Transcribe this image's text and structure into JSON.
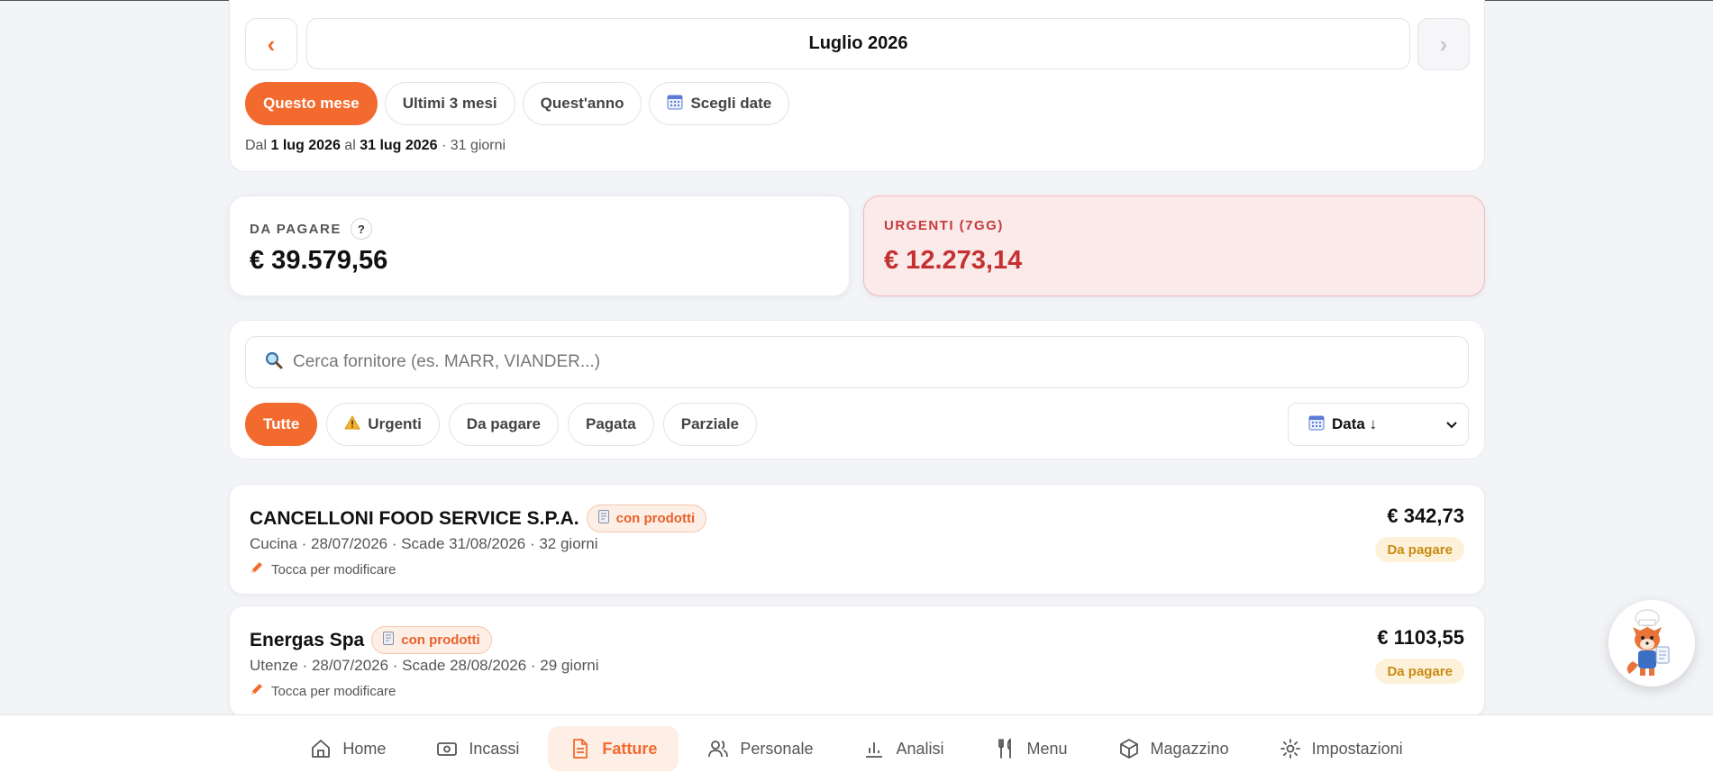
{
  "period": {
    "prev_symbol": "‹",
    "next_symbol": "›",
    "month_label": "Luglio 2026",
    "chips": [
      "Questo mese",
      "Ultimi 3 mesi",
      "Quest'anno",
      "Scegli date"
    ],
    "range": {
      "prefix": "Dal",
      "from": "1 lug 2026",
      "mid": "al",
      "to": "31 lug 2026",
      "suffix": "· 31 giorni"
    }
  },
  "totals": {
    "to_pay": {
      "label": "DA PAGARE",
      "help": "?",
      "value": "€ 39.579,56"
    },
    "urgent": {
      "label": "URGENTI (7GG)",
      "value": "€ 12.273,14"
    }
  },
  "filters": {
    "search_placeholder": "Cerca fornitore (es. MARR, VIANDER...)",
    "chips": [
      "Tutte",
      "Urgenti",
      "Da pagare",
      "Pagata",
      "Parziale"
    ],
    "sort_label": "Data ↓"
  },
  "invoices": [
    {
      "supplier": "CANCELLONI FOOD SERVICE S.P.A.",
      "badge": "con prodotti",
      "meta": "Cucina · 28/07/2026 · Scade 31/08/2026 · 32 giorni",
      "edit_hint": "Tocca per modificare",
      "amount": "€ 342,73",
      "status": "Da pagare"
    },
    {
      "supplier": "Energas Spa",
      "badge": "con prodotti",
      "meta": "Utenze · 28/07/2026 · Scade 28/08/2026 · 29 giorni",
      "edit_hint": "Tocca per modificare",
      "amount": "€ 1103,55",
      "status": "Da pagare"
    }
  ],
  "bottom_nav": [
    "Home",
    "Incassi",
    "Fatture",
    "Personale",
    "Analisi",
    "Menu",
    "Magazzino",
    "Impostazioni"
  ],
  "colors": {
    "accent": "#f26a2e",
    "urgent": "#c53030",
    "status_pending": "#c98a12"
  }
}
